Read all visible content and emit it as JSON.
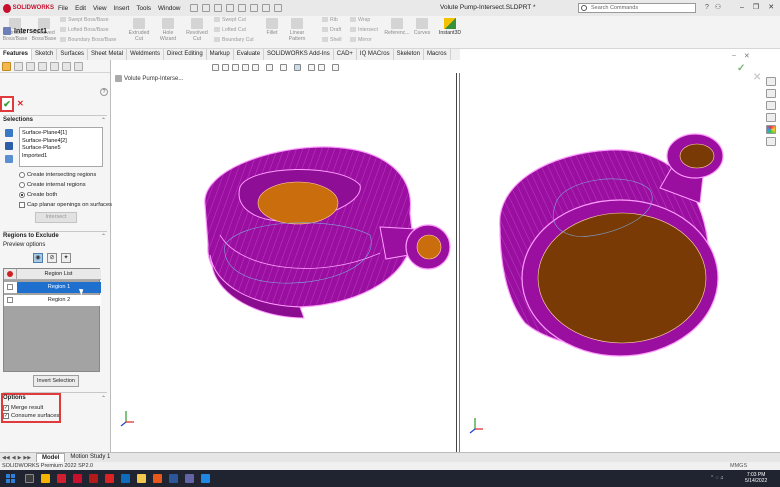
{
  "app": {
    "logo": "SOLIDWORKS",
    "document_title": "Volute Pump-Intersect.SLDPRT *"
  },
  "menu": [
    "File",
    "Edit",
    "View",
    "Insert",
    "Tools",
    "Window"
  ],
  "search": {
    "placeholder": "Search Commands"
  },
  "ribbon": {
    "extruded_boss": "Extruded Boss/Base",
    "revolved_boss": "Revolved Boss/Base",
    "swept_boss": "Swept Boss/Base",
    "lofted_boss": "Lofted Boss/Base",
    "boundary_boss": "Boundary Boss/Base",
    "extruded_cut": "Extruded Cut",
    "hole_wizard": "Hole Wizard",
    "revolved_cut": "Revolved Cut",
    "swept_cut": "Swept Cut",
    "lofted_cut": "Lofted Cut",
    "boundary_cut": "Boundary Cut",
    "fillet": "Fillet",
    "linear_pattern": "Linear Pattern",
    "rib": "Rib",
    "draft": "Draft",
    "shell": "Shell",
    "wrap": "Wrap",
    "intersect": "Intersect",
    "mirror": "Mirror",
    "reference": "Referenc...",
    "curves": "Curves",
    "instant3d": "Instant3D"
  },
  "command_tabs": [
    "Features",
    "Sketch",
    "Surfaces",
    "Sheet Metal",
    "Weldments",
    "Direct Editing",
    "Markup",
    "Evaluate",
    "SOLIDWORKS Add-Ins",
    "CAD+",
    "IQ MACros",
    "Skeleton",
    "Macros"
  ],
  "property_manager": {
    "title": "Intersect1",
    "selections_title": "Selections",
    "selections": [
      "Surface-Plane4[1]",
      "Surface-Plane4[2]",
      "Surface-Plane5",
      "Imported1"
    ],
    "options": {
      "intersecting": "Create intersecting regions",
      "internal": "Create internal regions",
      "both": "Create both",
      "cap": "Cap planar openings on surfaces"
    },
    "intersect_button": "Intersect",
    "regions_title": "Regions to Exclude",
    "preview_options": "Preview options",
    "region_list_header": "Region List",
    "regions": [
      "Region 1",
      "Region 2"
    ],
    "invert_selection": "Invert Selection",
    "options_title": "Options",
    "merge_result": "Merge result",
    "consume_surfaces": "Consume surfaces"
  },
  "viewport": {
    "tree_item": "Volute Pump-Interse..."
  },
  "bottom_tabs": [
    "Model",
    "Motion Study 1"
  ],
  "status": {
    "left": "SOLIDWORKS Premium 2022 SP2.0",
    "units": "MMGS"
  },
  "taskbar": {
    "time": "7:03 PM",
    "date": "5/14/2022"
  },
  "colors": {
    "body_magenta": "#9a0fa0",
    "face_orange": "#c96d0d",
    "face_brown": "#7a3a05",
    "accent_red": "#e03a3a"
  }
}
